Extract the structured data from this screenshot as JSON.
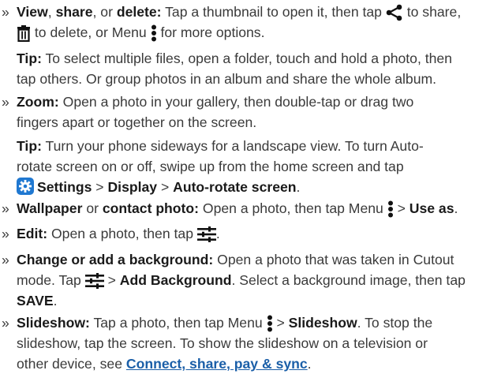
{
  "view_share_delete": {
    "bullet": "»",
    "term_view": "View",
    "sep1": ", ",
    "term_share": "share",
    "sep2": ", or ",
    "term_delete": "delete:",
    "text1": " Tap a thumbnail to open it, then tap ",
    "text2": " to share,",
    "text3": " to delete, or Menu ",
    "text4": " for more options."
  },
  "tip1": {
    "label": "Tip:",
    "line1": " To select multiple files, open a folder, touch and hold a photo, then",
    "line2": "tap others. Or group photos in an album and share the whole album."
  },
  "zoom": {
    "bullet": "»",
    "term": "Zoom:",
    "line1": " Open a photo in your gallery, then double-tap or drag two",
    "line2": "fingers apart or together on the screen."
  },
  "tip2": {
    "label": "Tip:",
    "line1": " Turn your phone sideways for a landscape view. To turn Auto-",
    "line2": "rotate screen on or off, swipe up from the home screen and tap",
    "settings": "Settings",
    "gt1": " > ",
    "display": "Display",
    "gt2": " > ",
    "autorotate": "Auto-rotate screen",
    "end": "."
  },
  "wallpaper": {
    "bullet": "»",
    "term1": "Wallpaper",
    "or": " or ",
    "term2": "contact photo:",
    "text": " Open a photo, then tap Menu ",
    "gt": " > ",
    "use_as": "Use as",
    "end": "."
  },
  "edit": {
    "bullet": "»",
    "term": "Edit:",
    "text": " Open a photo, then tap ",
    "end": "."
  },
  "background": {
    "bullet": "»",
    "term": "Change or add a background:",
    "line1": " Open a photo that was taken in Cutout",
    "line2a": "mode. Tap ",
    "gt": " > ",
    "add_bg": "Add Background",
    "line2b": ". Select a background image, then tap",
    "save": "SAVE",
    "end": "."
  },
  "slideshow": {
    "bullet": "»",
    "term": "Slideshow:",
    "text1": " Tap a photo, then tap Menu ",
    "gt": " > ",
    "slideshow_bold": "Slideshow",
    "text2": ". To stop the",
    "line2": "slideshow, tap the screen. To show the slideshow on a television or",
    "line3": "other device, see ",
    "link": "Connect, share, pay & sync",
    "end": "."
  },
  "icons": [
    "share-icon",
    "trash-icon",
    "menu-dots-icon",
    "settings-gear-icon",
    "edit-sliders-icon"
  ],
  "colors": {
    "text": "#3a3a3a",
    "bold": "#1a1a1a",
    "link": "#1b5fa8",
    "settings_icon_bg": "#1f78d1"
  }
}
